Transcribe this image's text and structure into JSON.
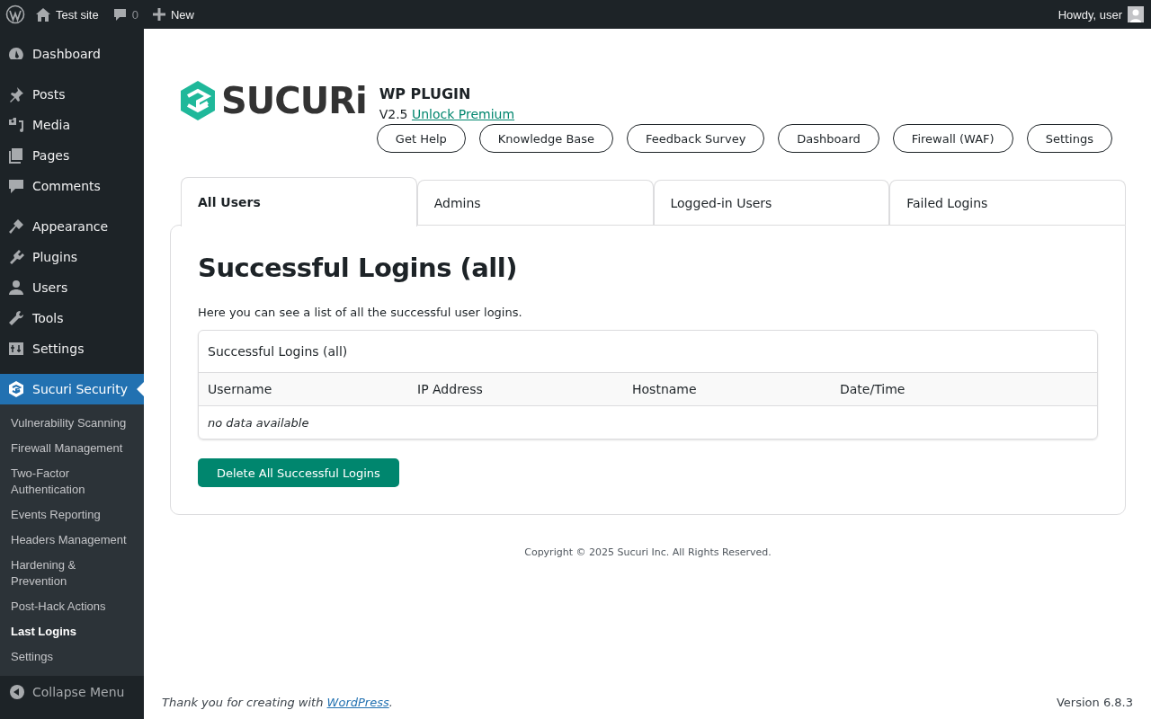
{
  "admin_bar": {
    "site": "Test site",
    "comments": "0",
    "new": "New",
    "greeting": "Howdy, user"
  },
  "sidebar": {
    "groups": [
      {
        "items": [
          {
            "label": "Dashboard",
            "selected": false
          }
        ]
      },
      {
        "items": [
          {
            "label": "Posts",
            "selected": false
          },
          {
            "label": "Media",
            "selected": false
          },
          {
            "label": "Pages",
            "selected": false
          },
          {
            "label": "Comments",
            "selected": false
          }
        ]
      },
      {
        "items": [
          {
            "label": "Appearance",
            "selected": false
          },
          {
            "label": "Plugins",
            "selected": false
          },
          {
            "label": "Users",
            "selected": false
          },
          {
            "label": "Tools",
            "selected": false
          },
          {
            "label": "Settings",
            "selected": false
          }
        ]
      }
    ],
    "current": {
      "label": "Sucuri Security",
      "selected": true,
      "submenu": [
        {
          "label": "Vulnerability Scanning",
          "selected": false
        },
        {
          "label": "Firewall Management",
          "selected": false
        },
        {
          "label": "Two-Factor Authentication",
          "selected": false
        },
        {
          "label": "Events Reporting",
          "selected": false
        },
        {
          "label": "Headers Management",
          "selected": false
        },
        {
          "label": "Hardening & Prevention",
          "selected": false
        },
        {
          "label": "Post-Hack Actions",
          "selected": false
        },
        {
          "label": "Last Logins",
          "selected": true
        },
        {
          "label": "Settings",
          "selected": false
        }
      ]
    },
    "collapse": "Collapse Menu"
  },
  "header": {
    "logo": "SUCURi",
    "product": "WP PLUGIN",
    "version": "V2.5",
    "premium_link": "Unlock Premium",
    "buttons": [
      "Get Help",
      "Knowledge Base",
      "Feedback Survey",
      "Dashboard",
      "Firewall (WAF)",
      "Settings"
    ]
  },
  "tabs": [
    {
      "label": "All Users",
      "selected": true
    },
    {
      "label": "Admins",
      "selected": false
    },
    {
      "label": "Logged-in Users",
      "selected": false
    },
    {
      "label": "Failed Logins",
      "selected": false
    }
  ],
  "panel": {
    "title": "Successful Logins (all)",
    "description": "Here you can see a list of all the successful user logins.",
    "table": {
      "caption": "Successful Logins (all)",
      "columns": [
        "Username",
        "IP Address",
        "Hostname",
        "Date/Time"
      ],
      "empty": "no data available"
    },
    "action": "Delete All Successful Logins"
  },
  "copyright": "Copyright © 2025 Sucuri Inc. All Rights Reserved.",
  "footer": {
    "thanks": "Thank you for creating with ",
    "link": "WordPress",
    "thanks_end": ".",
    "version": "Version 6.8.3"
  }
}
